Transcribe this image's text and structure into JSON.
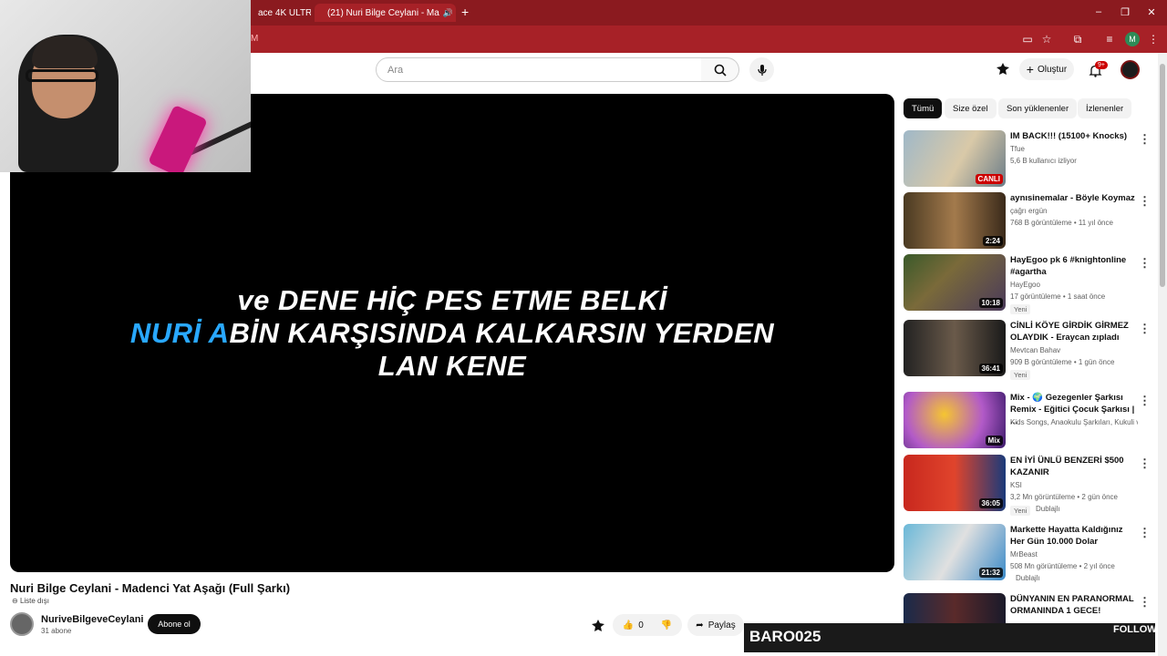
{
  "browser": {
    "tabs": [
      {
        "label": "ace 4K ULTR"
      },
      {
        "label": "(21) Nuri Bilge Ceylani - Ma",
        "active": true
      }
    ],
    "new_tab": "+",
    "address_fragment": "M",
    "profile_letter": "M",
    "window_controls": [
      "–",
      "❐",
      "✕"
    ]
  },
  "youtube": {
    "search": {
      "placeholder": "Ara"
    },
    "create_label": "Oluştur",
    "notifications_badge": "9+"
  },
  "player": {
    "lyrics": {
      "line1": "ve DENE HİÇ PES ETME BELKİ",
      "line2_highlight": "NURİ A",
      "line2_rest": "BİN KARŞISINDA KALKARSIN YERDEN",
      "line3": "LAN KENE"
    }
  },
  "video": {
    "title": "Nuri Bilge Ceylani - Madenci Yat Aşağı (Full Şarkı)",
    "playlist": "Liste dışı",
    "channel_name": "NuriveBilgeveCeylani",
    "subscribers": "31 abone",
    "subscribe_label": "Abone ol",
    "likes": "0",
    "share_label": "Paylaş"
  },
  "chips": [
    "Tümü",
    "Size özel",
    "Son yüklenenler",
    "İzlenenler"
  ],
  "recommendations": [
    {
      "title": "IM BACK!!! (15100+ Knocks)",
      "channel": "Tfue",
      "meta": "5,6 B kullanıcı izliyor",
      "duration": "CANLI",
      "live": true,
      "new": ""
    },
    {
      "title": "aynısinemalar - Böyle Koymaz",
      "channel": "çağrı ergün",
      "meta": "768 B görüntüleme • 11 yıl önce",
      "duration": "2:24",
      "live": false,
      "new": ""
    },
    {
      "title": "HayEgoo pk 6 #knightonline #agartha",
      "channel": "HayEgoo",
      "meta": "17 görüntüleme • 1 saat önce",
      "duration": "10:18",
      "live": false,
      "new": "Yeni"
    },
    {
      "title": "CİNLİ KÖYE GİRDİK GİRMEZ OLAYDIK - Eraycan zıpladı",
      "channel": "Mevtcan Bahav",
      "meta": "909 B görüntüleme • 1 gün önce",
      "duration": "36:41",
      "live": false,
      "new": "Yeni"
    },
    {
      "title": "Mix - 🌍 Gezegenler Şarkısı Remix - Eğitici Çocuk Şarkısı | ...",
      "channel": "Kids Songs, Anaokulu Şarkıları, Kukuli ve ...",
      "meta": "",
      "duration": "Mix",
      "live": false,
      "new": ""
    },
    {
      "title": "EN İYİ ÜNLÜ BENZERİ $500 KAZANIR",
      "channel": "KSI",
      "meta": "3,2 Mn görüntüleme • 2 gün önce",
      "duration": "36:05",
      "live": false,
      "new": "Yeni",
      "extra": "Dublajlı"
    },
    {
      "title": "Markette Hayatta Kaldığınız Her Gün 10.000 Dolar",
      "channel": "MrBeast",
      "meta": "508 Mn görüntüleme • 2 yıl önce",
      "duration": "21:32",
      "live": false,
      "new": "",
      "extra": "Dublajlı"
    },
    {
      "title": "DÜNYANIN EN PARANORMAL ORMANINDA 1 GECE!",
      "channel": "",
      "meta": "",
      "duration": "",
      "live": false,
      "new": ""
    }
  ],
  "stream_overlay": {
    "name": "BARO025",
    "follow": "FOLLOW"
  },
  "colors": {
    "browser_red": "#a72127",
    "accent_blue": "#29a8ff",
    "yt_red": "#cc0000"
  }
}
